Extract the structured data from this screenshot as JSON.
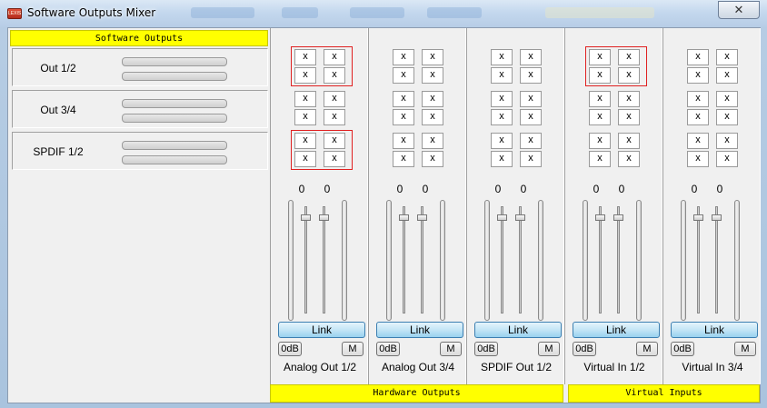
{
  "window": {
    "title": "Software Outputs Mixer",
    "close_label": "✕",
    "icon_text": "LEXIS"
  },
  "software_outputs": {
    "header": "Software Outputs",
    "rows": [
      {
        "label": "Out 1/2"
      },
      {
        "label": "Out 3/4"
      },
      {
        "label": "SPDIF 1/2"
      }
    ]
  },
  "routing_cell_label": "x",
  "channels": [
    {
      "name": "Analog Out 1/2",
      "gain_left": "0",
      "gain_right": "0",
      "link_label": "Link",
      "odb_label": "0dB",
      "mute_label": "M"
    },
    {
      "name": "Analog Out 3/4",
      "gain_left": "0",
      "gain_right": "0",
      "link_label": "Link",
      "odb_label": "0dB",
      "mute_label": "M"
    },
    {
      "name": "SPDIF Out 1/2",
      "gain_left": "0",
      "gain_right": "0",
      "link_label": "Link",
      "odb_label": "0dB",
      "mute_label": "M"
    },
    {
      "name": "Virtual In 1/2",
      "gain_left": "0",
      "gain_right": "0",
      "link_label": "Link",
      "odb_label": "0dB",
      "mute_label": "M"
    },
    {
      "name": "Virtual In 3/4",
      "gain_left": "0",
      "gain_right": "0",
      "link_label": "Link",
      "odb_label": "0dB",
      "mute_label": "M"
    }
  ],
  "footers": {
    "hardware": "Hardware Outputs",
    "virtual": "Virtual Inputs"
  },
  "colors": {
    "section_header": "#ffff00",
    "highlight_box": "#e02020",
    "link_button": "#98d1ef"
  }
}
